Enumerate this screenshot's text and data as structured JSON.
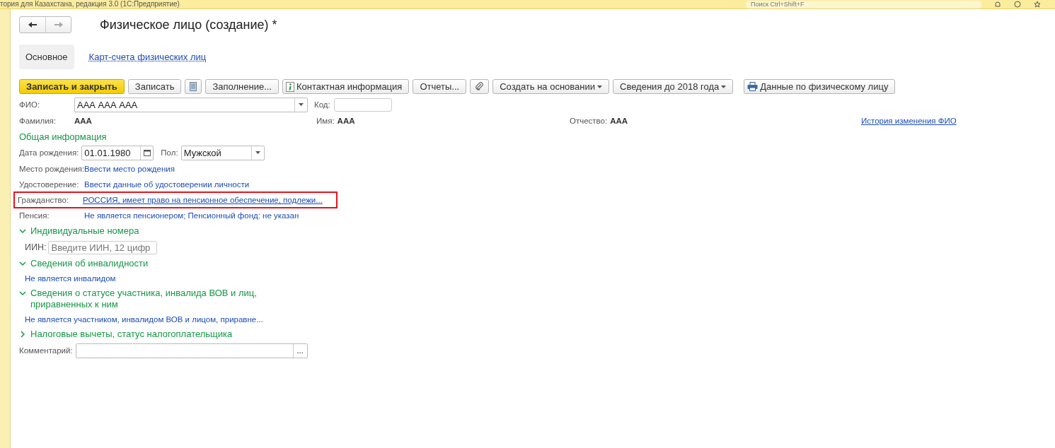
{
  "app_bar": {
    "title": "тория для Казахстана, редакция 3.0  (1С:Предприятие)",
    "search": {
      "placeholder": "Поиск Ctrl+Shift+F"
    }
  },
  "form": {
    "title": "Физическое лицо (создание) *",
    "tabs": [
      {
        "label": "Основное",
        "selected": true
      },
      {
        "label": "Карт-счета физических лиц",
        "selected": false
      }
    ],
    "toolbar": [
      {
        "kind": "primary",
        "label": "Записать и закрыть"
      },
      {
        "kind": "text",
        "label": "Записать"
      },
      {
        "kind": "list"
      },
      {
        "kind": "text",
        "label": "Заполнение..."
      },
      {
        "kind": "info",
        "label": "Контактная информация"
      },
      {
        "kind": "text",
        "label": "Отчеты..."
      },
      {
        "kind": "clip"
      },
      {
        "kind": "menu",
        "label": "Создать на основании"
      },
      {
        "kind": "menu",
        "label": "Сведения до 2018 года"
      },
      {
        "kind": "print",
        "label": "Данные по физическому лицу"
      }
    ],
    "fio": {
      "label": "ФИО:",
      "value": "ААА ААА ААА",
      "code_label": "Код:"
    },
    "name_parts": [
      {
        "label": "Фамилия:",
        "value": "ААА"
      },
      {
        "label": "Имя:",
        "value": "ААА"
      },
      {
        "label": "Отчество:",
        "value": "ААА"
      }
    ],
    "history_link": "История изменения ФИО",
    "general": {
      "title": "Общая информация",
      "birth_date": {
        "label": "Дата рождения:",
        "value": "01.01.1980"
      },
      "gender": {
        "label": "Пол:",
        "value": "Мужской"
      },
      "rows": [
        {
          "label": "Место рождения:",
          "value": "Ввести место рождения",
          "highlighted": false
        },
        {
          "label": "Удостоверение:",
          "value": "Ввести данные об удостоверении личности",
          "highlighted": false
        },
        {
          "label": "Гражданство:",
          "value": "РОССИЯ, имеет право на пенсионное обеспечение, подлежи...",
          "highlighted": true
        },
        {
          "label": "Пенсия:",
          "value": "Не является пенсионером; Пенсионный фонд: не указан",
          "highlighted": false
        }
      ]
    },
    "groups": [
      {
        "title": "Индивидуальные номера",
        "expanded": true,
        "kind": "field",
        "label": "ИИН:",
        "placeholder": "Введите ИИН, 12 цифр"
      },
      {
        "title": "Сведения об инвалидности",
        "expanded": true,
        "kind": "link",
        "value": "Не является инвалидом"
      },
      {
        "title": "Сведения о статусе участника, инвалида ВОВ и лиц, приравненных к ним",
        "expanded": true,
        "kind": "link",
        "value": "Не является участником, инвалидом ВОВ и лицом, приравне..."
      },
      {
        "title": "Налоговые вычеты, статус налогоплательщика",
        "expanded": false
      }
    ],
    "comment": {
      "label": "Комментарий:",
      "button": "..."
    }
  }
}
